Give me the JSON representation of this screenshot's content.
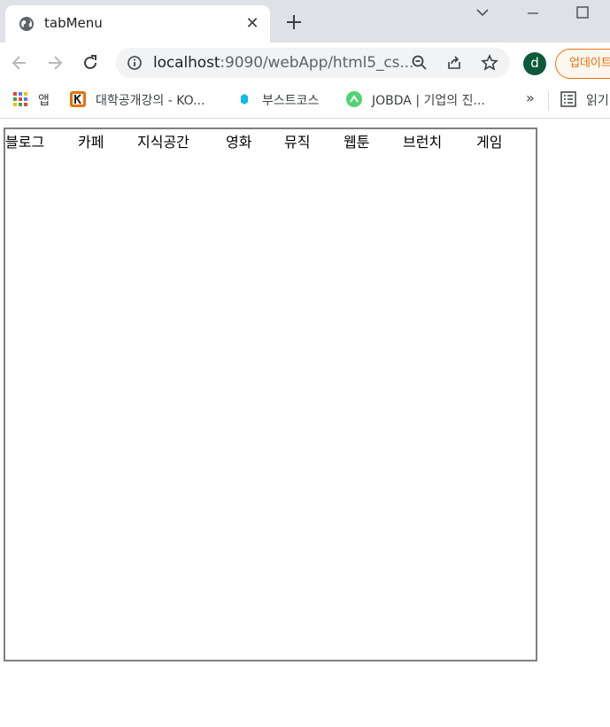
{
  "browser": {
    "tab": {
      "title": "tabMenu",
      "close_glyph": "✕"
    },
    "address": {
      "host": "localhost",
      "rest": ":9090/webApp/html5_cs..."
    },
    "profile_initial": "d",
    "update_label": "업데이트",
    "bookmarks": [
      {
        "label": "앱",
        "icon": "apps-grid-icon"
      },
      {
        "label": "대학공개강의 - KO...",
        "icon": "kocw-icon"
      },
      {
        "label": "부스트코스",
        "icon": "boostcourse-icon"
      },
      {
        "label": "JOBDA | 기업의 진...",
        "icon": "jobda-icon"
      }
    ],
    "more_bookmarks": "»",
    "reading_list": "읽기"
  },
  "page": {
    "menu": [
      "블로그",
      "카페",
      "지식공간",
      "영화",
      "뮤직",
      "웹툰",
      "브런치",
      "게임"
    ]
  },
  "colors": {
    "tab_strip": "#dee1e6",
    "omnibox": "#f1f3f4",
    "profile": "#0d5a3a",
    "update_accent": "#e8710a",
    "box_border": "#808080"
  }
}
